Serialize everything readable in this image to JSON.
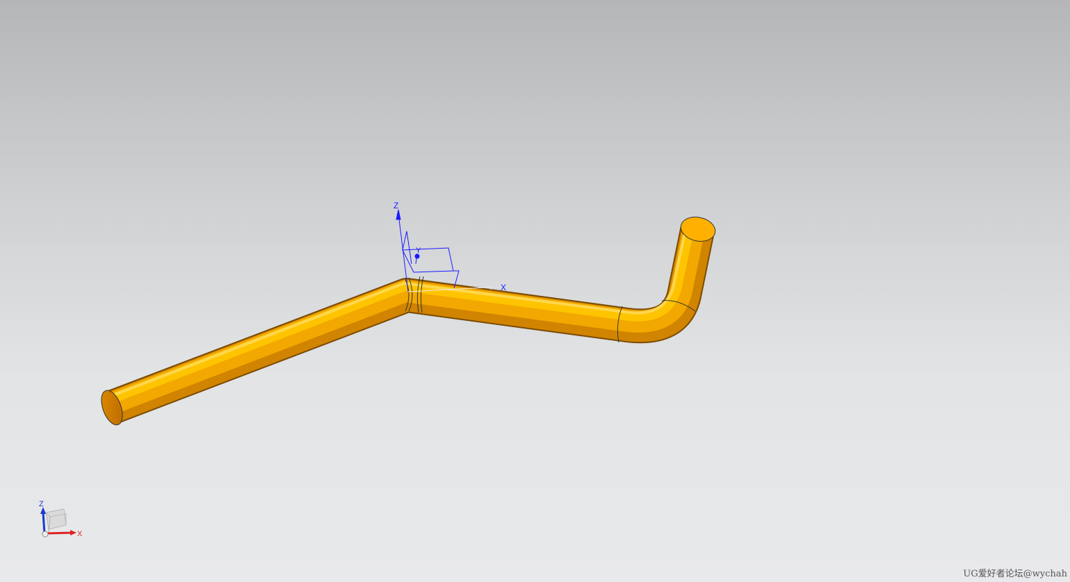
{
  "viewport": {
    "background_top": "#b5b6b8",
    "background_bottom": "#e8e9eb",
    "model_color": "#ffb300"
  },
  "csys": {
    "x_label": "X",
    "y_label": "Y",
    "z_label": "Z"
  },
  "view_triad": {
    "x_label": "X",
    "z_label": "Z"
  },
  "watermark": "UG爱好者论坛@wychah"
}
